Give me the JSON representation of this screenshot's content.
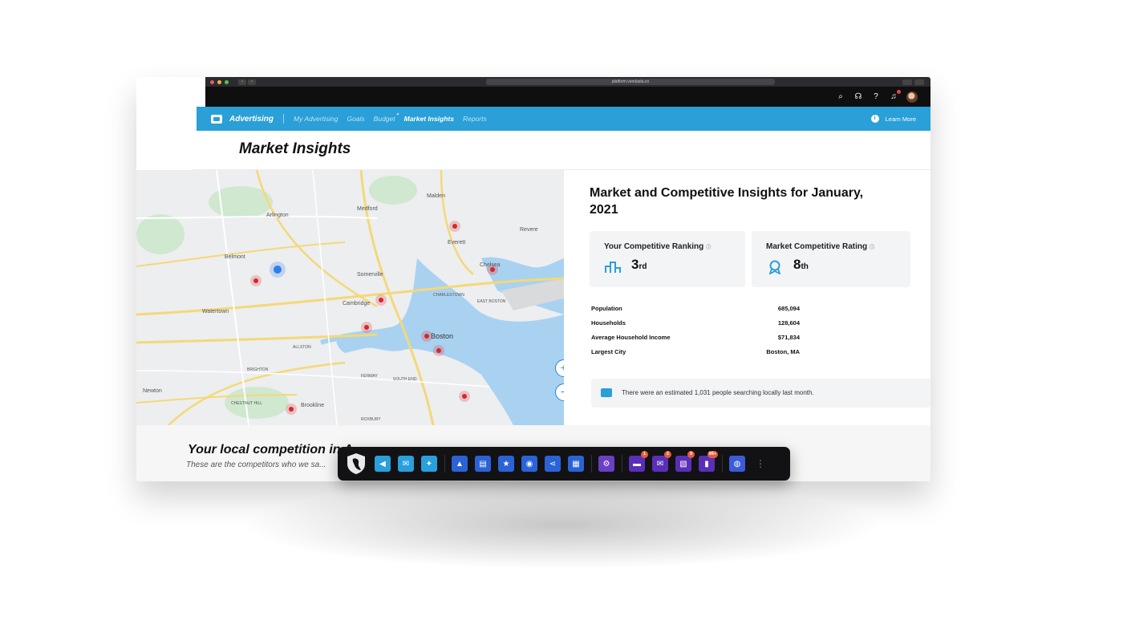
{
  "browser": {
    "url": "platform.vendasta.co"
  },
  "app": {
    "brand": "Advertising",
    "nav": [
      {
        "label": "My Advertising",
        "active": false
      },
      {
        "label": "Goals",
        "active": false
      },
      {
        "label": "Budget",
        "active": false,
        "flag": "✦"
      },
      {
        "label": "Market Insights",
        "active": true
      },
      {
        "label": "Reports",
        "active": false
      }
    ],
    "learn_more": "Learn More",
    "accent_color": "#2a9fd8"
  },
  "page": {
    "title": "Market Insights"
  },
  "map": {
    "labels": [
      "Malden",
      "Medford",
      "Arlington",
      "Everett",
      "Revere",
      "Belmont",
      "Chelsea",
      "Somerville",
      "Watertown",
      "Cambridge",
      "Boston",
      "Newton",
      "Brookline",
      "CHARLESTOWN",
      "ALLSTON",
      "FENWAY",
      "SOUTH END",
      "ROXBURY",
      "EAST BOSTON",
      "BRIGHTON",
      "CHESTNUT HILL"
    ],
    "zoom_in": "+",
    "zoom_out": "−"
  },
  "insights": {
    "heading": "Market and Competitive Insights for January, 2021",
    "ranking": {
      "title": "Your Competitive Ranking",
      "value": "3",
      "suffix": "rd",
      "icon": "podium-icon"
    },
    "rating": {
      "title": "Market Competitive Rating",
      "value": "8",
      "suffix": "th",
      "icon": "award-icon"
    },
    "stats": [
      {
        "label": "Population",
        "value": "685,094"
      },
      {
        "label": "Households",
        "value": "128,604"
      },
      {
        "label": "Average Household Income",
        "value": "$71,834"
      },
      {
        "label": "Largest City",
        "value": "Boston, MA"
      }
    ],
    "notice": "There were an estimated 1,031 people searching locally last month."
  },
  "competition": {
    "heading": "Your local competition in A...",
    "subtitle": "These are the competitors who we sa..."
  },
  "dock": {
    "badges": [
      "1",
      "2",
      "9",
      "99+"
    ]
  }
}
